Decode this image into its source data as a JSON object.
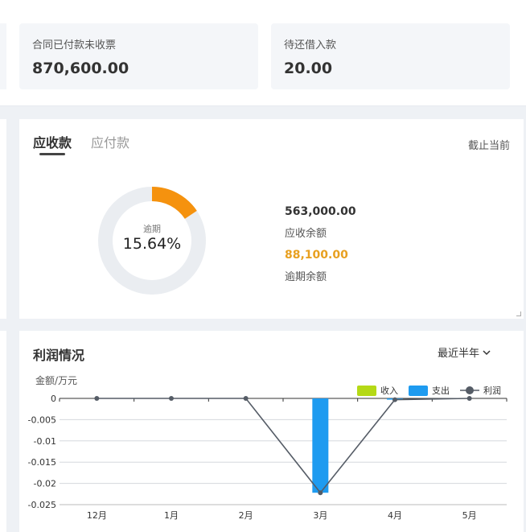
{
  "top_cards": [
    {
      "label": "合同已付款未收票",
      "value": "870,600.00"
    },
    {
      "label": "待还借入款",
      "value": "20.00"
    }
  ],
  "receivables": {
    "tabs": [
      {
        "label": "应收款",
        "active": true
      },
      {
        "label": "应付款",
        "active": false
      }
    ],
    "as_of": "截止当前",
    "donut": {
      "label": "逾期",
      "value_text": "15.64%",
      "percent": 15.64,
      "accent_color": "#f5920e",
      "track_color": "#eaedf1"
    },
    "balance_value": "563,000.00",
    "balance_label": "应收余额",
    "overdue_value": "88,100.00",
    "overdue_label": "逾期余额",
    "overdue_color": "#e8a020"
  },
  "profit": {
    "title": "利润情况",
    "range_label": "最近半年",
    "range_icon": "chevron-down-icon",
    "chart_data": {
      "type": "bar",
      "ylabel": "金额/万元",
      "categories": [
        "12月",
        "1月",
        "2月",
        "3月",
        "4月",
        "5月"
      ],
      "ylim": [
        -0.025,
        0
      ],
      "yticks": [
        0,
        -0.005,
        -0.01,
        -0.015,
        -0.02,
        -0.025
      ],
      "ytick_labels": [
        "0",
        "-0.005",
        "-0.01",
        "-0.015",
        "-0.02",
        "-0.025"
      ],
      "legend_position": "top-right",
      "grid": true,
      "series": [
        {
          "name": "收入",
          "type": "bar",
          "color": "#b5d916",
          "values": [
            0,
            0,
            0,
            0,
            0,
            0
          ]
        },
        {
          "name": "支出",
          "type": "bar",
          "color": "#1e9bf0",
          "values": [
            0,
            0,
            0,
            -0.0222,
            -0.0003,
            0
          ]
        },
        {
          "name": "利润",
          "type": "line",
          "color": "#555c66",
          "values": [
            0,
            0,
            0,
            -0.0222,
            -0.0003,
            0
          ]
        }
      ]
    }
  }
}
